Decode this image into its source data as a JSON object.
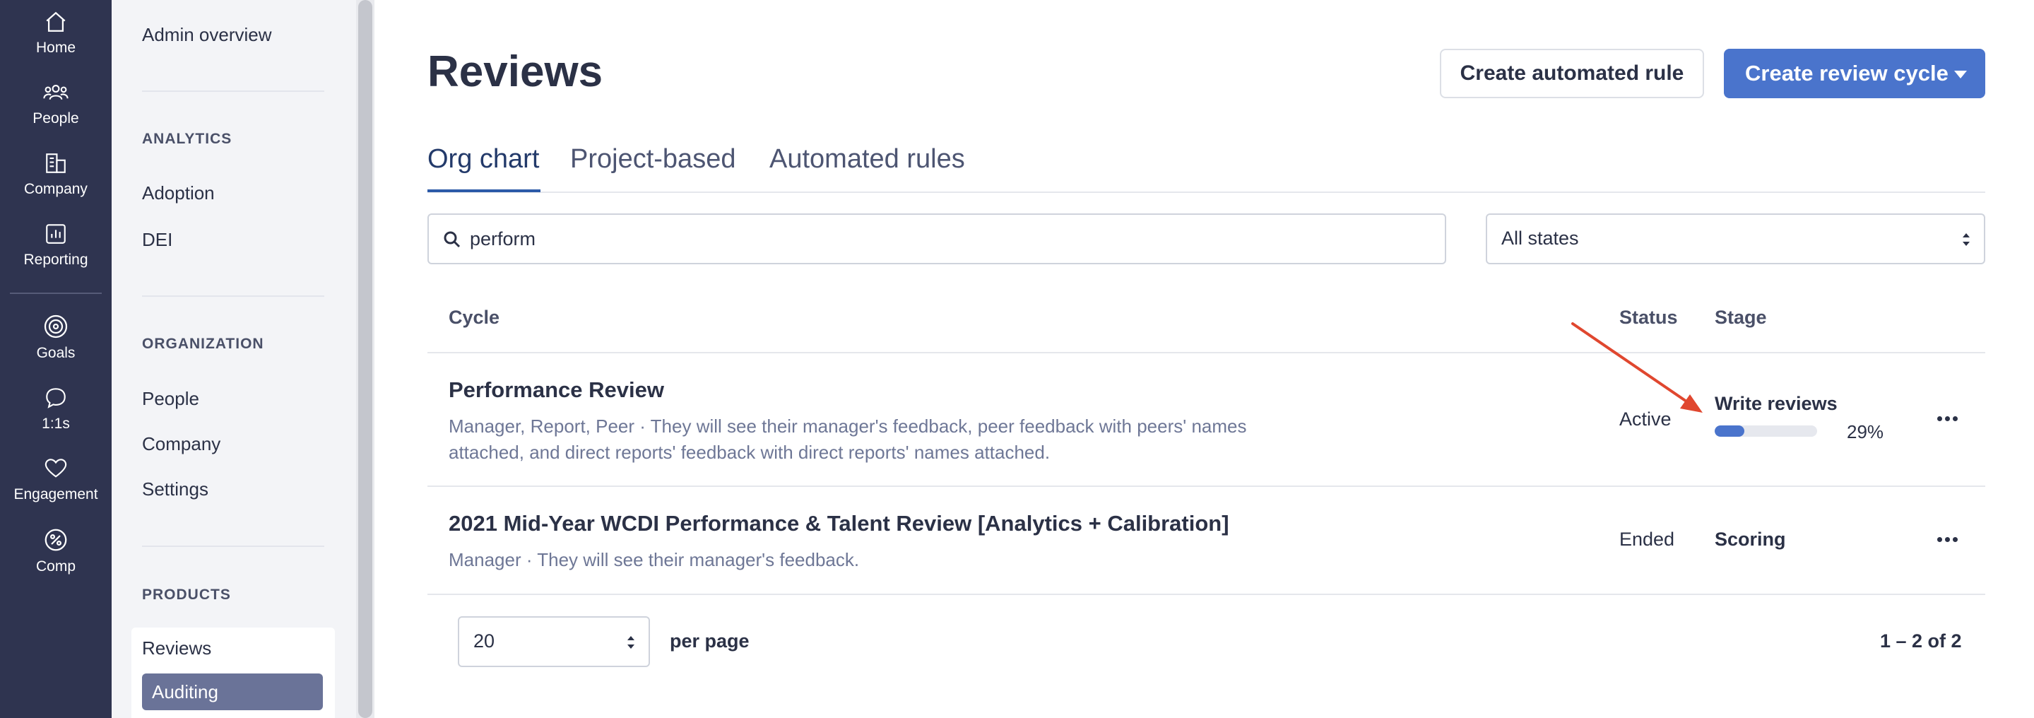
{
  "rail": {
    "items": [
      {
        "label": "Home",
        "icon": "home-icon"
      },
      {
        "label": "People",
        "icon": "people-icon"
      },
      {
        "label": "Company",
        "icon": "company-icon"
      },
      {
        "label": "Reporting",
        "icon": "reporting-icon"
      },
      {
        "label": "Goals",
        "icon": "goals-icon"
      },
      {
        "label": "1:1s",
        "icon": "chat-icon"
      },
      {
        "label": "Engagement",
        "icon": "heart-icon"
      },
      {
        "label": "Comp",
        "icon": "comp-icon"
      }
    ]
  },
  "sidebar": {
    "admin_overview": "Admin overview",
    "sections": [
      {
        "title": "ANALYTICS",
        "items": [
          "Adoption",
          "DEI"
        ]
      },
      {
        "title": "ORGANIZATION",
        "items": [
          "People",
          "Company",
          "Settings"
        ]
      },
      {
        "title": "PRODUCTS",
        "items": [
          "Reviews",
          "Auditing"
        ]
      }
    ]
  },
  "header": {
    "title": "Reviews",
    "create_rule_label": "Create automated rule",
    "create_cycle_label": "Create review cycle"
  },
  "tabs": [
    {
      "label": "Org chart",
      "active": true
    },
    {
      "label": "Project-based",
      "active": false
    },
    {
      "label": "Automated rules",
      "active": false
    }
  ],
  "filters": {
    "search_value": "perform",
    "state_selected": "All states"
  },
  "table": {
    "headers": {
      "cycle": "Cycle",
      "status": "Status",
      "stage": "Stage"
    },
    "rows": [
      {
        "title": "Performance Review",
        "description": "Manager, Report, Peer · They will see their manager's feedback, peer feedback with peers' names attached, and direct reports' feedback with direct reports' names attached.",
        "status": "Active",
        "stage": "Write reviews",
        "progress": 29,
        "progress_label": "29%"
      },
      {
        "title": "2021 Mid-Year WCDI Performance & Talent Review [Analytics + Calibration]",
        "description": "Manager · They will see their manager's feedback.",
        "status": "Ended",
        "stage": "Scoring"
      }
    ]
  },
  "pagination": {
    "per_page_value": "20",
    "per_page_label": "per page",
    "range_label": "1 – 2 of 2"
  },
  "colors": {
    "rail_bg": "#2f3450",
    "primary": "#4a74cc",
    "annotation_arrow": "#e0472f"
  }
}
